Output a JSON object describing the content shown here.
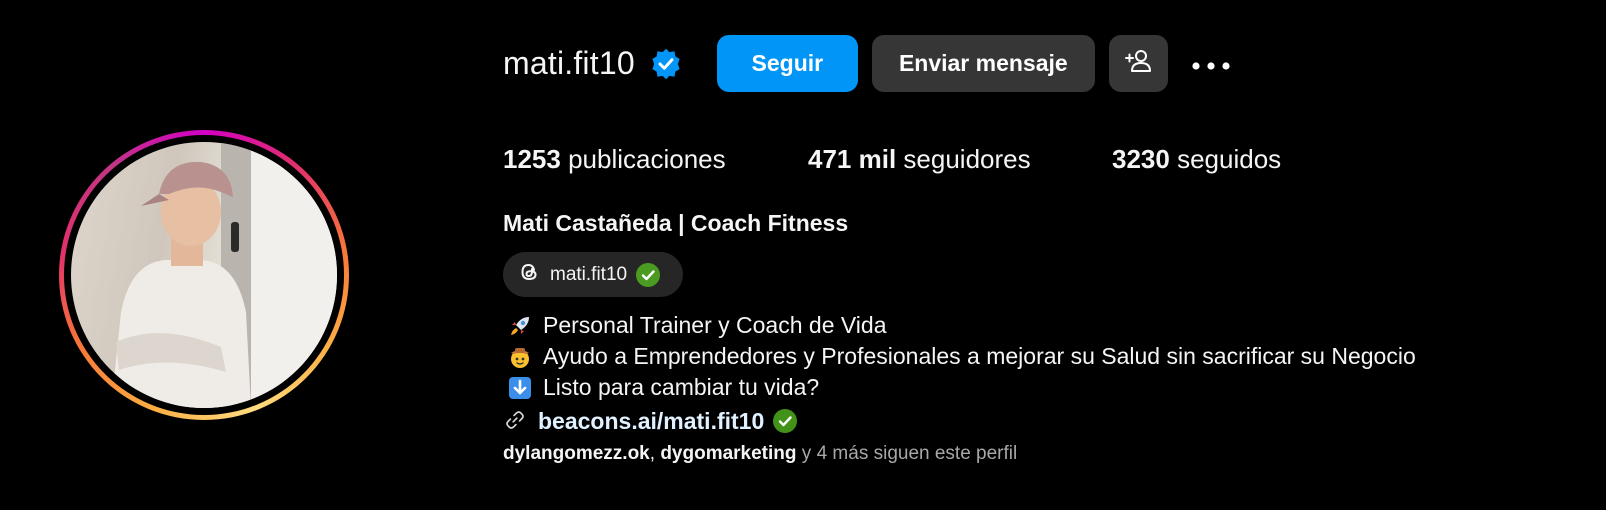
{
  "profile": {
    "username": "mati.fit10",
    "follow_label": "Seguir",
    "message_label": "Enviar mensaje",
    "more_label": "•••"
  },
  "stats": {
    "posts_count": "1253",
    "posts_label": "publicaciones",
    "followers_count": "471 mil",
    "followers_label": "seguidores",
    "following_count": "3230",
    "following_label": "seguidos"
  },
  "bio": {
    "full_name": "Mati Castañeda | Coach Fitness",
    "threads_handle": "mati.fit10",
    "lines": [
      {
        "emoji": "rocket",
        "text": "Personal Trainer y Coach de Vida"
      },
      {
        "emoji": "cowboy-face",
        "text": "Ayudo a Emprendedores y Profesionales a mejorar su Salud sin sacrificar su Negocio"
      },
      {
        "emoji": "down-arrow-button",
        "text": "Listo para cambiar tu vida?"
      }
    ],
    "link": "beacons.ai/mati.fit10"
  },
  "followed_by": {
    "account_1": "dylangomezz.ok",
    "separator": ",",
    "account_2": "dygomarketing",
    "rest": "y 4 más siguen este perfil"
  },
  "colors": {
    "background": "#000000",
    "primary_button": "#0095f6",
    "secondary_button": "#363636",
    "verified_blue": "#0095f6",
    "verified_green": "#58c322"
  }
}
